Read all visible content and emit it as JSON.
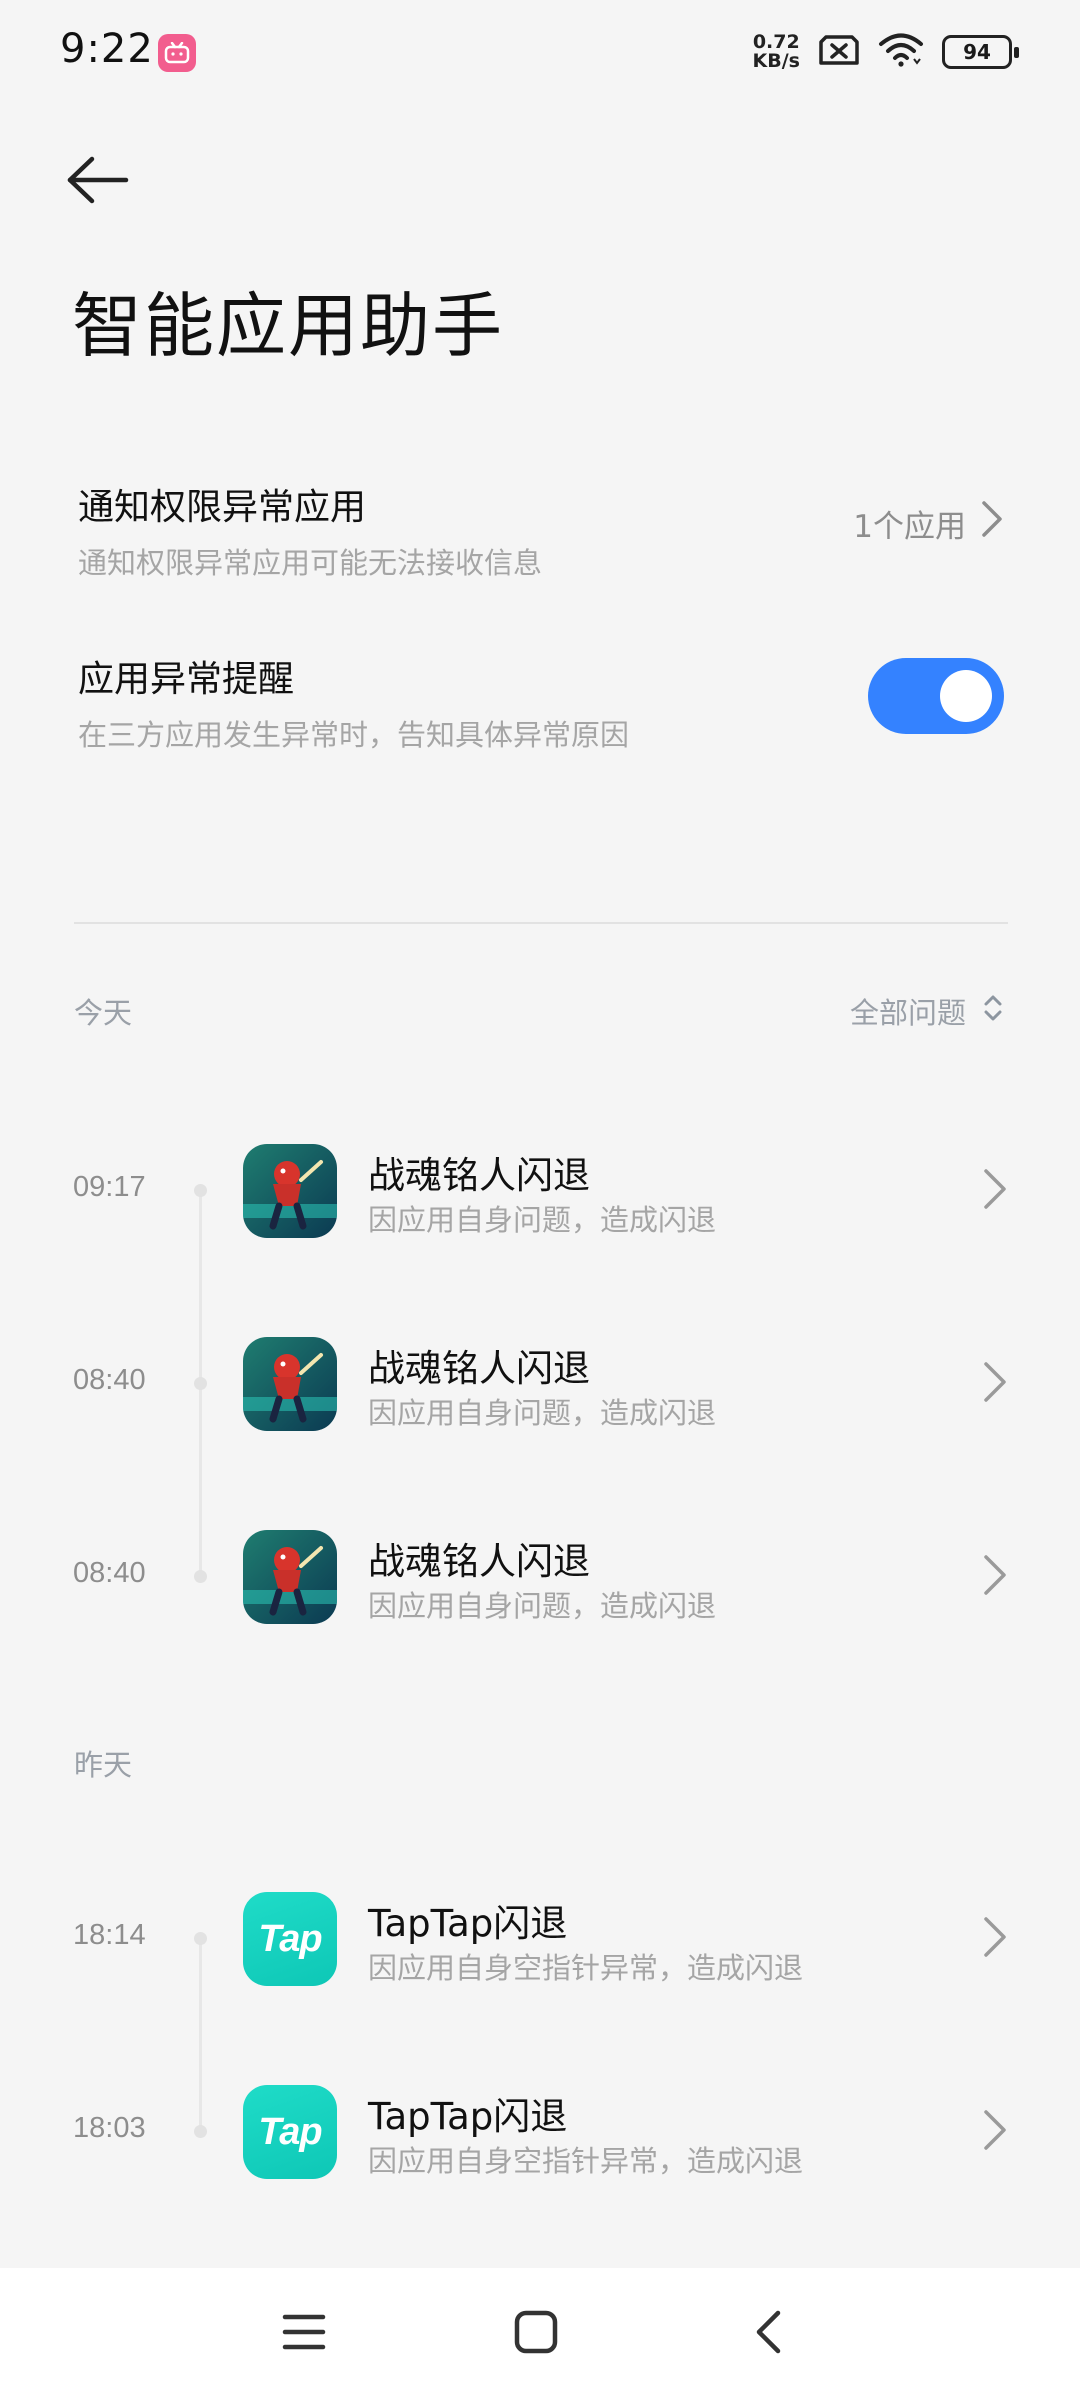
{
  "status_bar": {
    "time": "9:22",
    "app_icon": "bilibili-icon",
    "speed_value": "0.72",
    "speed_unit": "KB/s",
    "battery": "94",
    "icons": [
      "sim-no-signal-icon",
      "wifi-icon",
      "battery-icon"
    ]
  },
  "header": {
    "back_icon": "arrow-left-icon",
    "title": "智能应用助手"
  },
  "settings": {
    "notification": {
      "title": "通知权限异常应用",
      "subtitle": "通知权限异常应用可能无法接收信息",
      "value": "1个应用"
    },
    "alert": {
      "title": "应用异常提醒",
      "subtitle": "在三方应用发生异常时，告知具体异常原因",
      "enabled": true
    }
  },
  "filter": {
    "label": "全部问题",
    "icon": "sort-updown-icon"
  },
  "sections": [
    {
      "label": "今天",
      "events": [
        {
          "time": "09:17",
          "title": "战魂铭人闪退",
          "subtitle": "因应用自身问题，造成闪退",
          "icon": "soul-knight-game-icon"
        },
        {
          "time": "08:40",
          "title": "战魂铭人闪退",
          "subtitle": "因应用自身问题，造成闪退",
          "icon": "soul-knight-game-icon"
        },
        {
          "time": "08:40",
          "title": "战魂铭人闪退",
          "subtitle": "因应用自身问题，造成闪退",
          "icon": "soul-knight-game-icon"
        }
      ]
    },
    {
      "label": "昨天",
      "events": [
        {
          "time": "18:14",
          "title": "TapTap闪退",
          "subtitle": "因应用自身空指针异常，造成闪退",
          "icon": "taptap-icon",
          "icon_text": "Tap"
        },
        {
          "time": "18:03",
          "title": "TapTap闪退",
          "subtitle": "因应用自身空指针异常，造成闪退",
          "icon": "taptap-icon",
          "icon_text": "Tap"
        }
      ]
    }
  ],
  "navigation": {
    "menu": "menu-icon",
    "home": "home-square-icon",
    "back": "back-triangle-icon"
  },
  "colors": {
    "accent": "#3482ff",
    "background": "#f5f5f5",
    "taptap": "#17d2bf"
  }
}
